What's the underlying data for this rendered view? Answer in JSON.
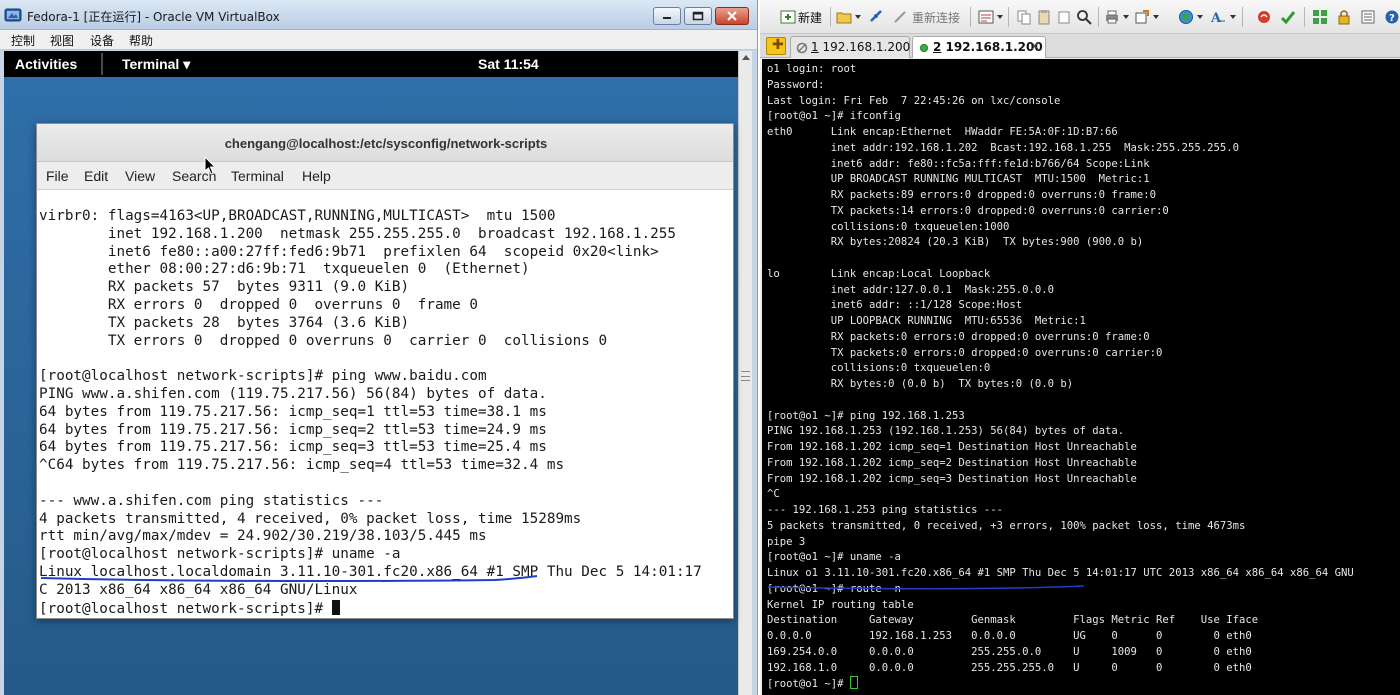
{
  "vbox": {
    "title": "Fedora-1 [正在运行] - Oracle VM VirtualBox",
    "menu": [
      "控制",
      "视图",
      "设备",
      "帮助"
    ]
  },
  "gnome": {
    "activities": "Activities",
    "app_menu": "Terminal ▾",
    "clock": "Sat 11:54"
  },
  "guest_terminal": {
    "title": "chengang@localhost:/etc/sysconfig/network-scripts",
    "menu": [
      "File",
      "Edit",
      "View",
      "Search",
      "Terminal",
      "Help"
    ],
    "lines": [
      "virbr0: flags=4163<UP,BROADCAST,RUNNING,MULTICAST>  mtu 1500",
      "        inet 192.168.1.200  netmask 255.255.255.0  broadcast 192.168.1.255",
      "        inet6 fe80::a00:27ff:fed6:9b71  prefixlen 64  scopeid 0x20<link>",
      "        ether 08:00:27:d6:9b:71  txqueuelen 0  (Ethernet)",
      "        RX packets 57  bytes 9311 (9.0 KiB)",
      "        RX errors 0  dropped 0  overruns 0  frame 0",
      "        TX packets 28  bytes 3764 (3.6 KiB)",
      "        TX errors 0  dropped 0 overruns 0  carrier 0  collisions 0",
      "",
      "[root@localhost network-scripts]# ping www.baidu.com",
      "PING www.a.shifen.com (119.75.217.56) 56(84) bytes of data.",
      "64 bytes from 119.75.217.56: icmp_seq=1 ttl=53 time=38.1 ms",
      "64 bytes from 119.75.217.56: icmp_seq=2 ttl=53 time=24.9 ms",
      "64 bytes from 119.75.217.56: icmp_seq=3 ttl=53 time=25.4 ms",
      "^C64 bytes from 119.75.217.56: icmp_seq=4 ttl=53 time=32.4 ms",
      "",
      "--- www.a.shifen.com ping statistics ---",
      "4 packets transmitted, 4 received, 0% packet loss, time 15289ms",
      "rtt min/avg/max/mdev = 24.902/30.219/38.103/5.445 ms",
      "[root@localhost network-scripts]# uname -a",
      "Linux localhost.localdomain 3.11.10-301.fc20.x86_64 #1 SMP Thu Dec 5 14:01:17",
      "C 2013 x86_64 x86_64 x86_64 GNU/Linux"
    ],
    "prompt": "[root@localhost network-scripts]# "
  },
  "crt": {
    "toolbar": {
      "new_label": "新建",
      "reconnect_label": "重新连接"
    },
    "tabs": [
      {
        "number": "1",
        "label": "192.168.1.200"
      },
      {
        "number": "2",
        "label": "192.168.1.200",
        "close": "×"
      }
    ],
    "lines": [
      "o1 login: root",
      "Password:",
      "Last login: Fri Feb  7 22:45:26 on lxc/console",
      "[root@o1 ~]# ifconfig",
      "eth0      Link encap:Ethernet  HWaddr FE:5A:0F:1D:B7:66",
      "          inet addr:192.168.1.202  Bcast:192.168.1.255  Mask:255.255.255.0",
      "          inet6 addr: fe80::fc5a:fff:fe1d:b766/64 Scope:Link",
      "          UP BROADCAST RUNNING MULTICAST  MTU:1500  Metric:1",
      "          RX packets:89 errors:0 dropped:0 overruns:0 frame:0",
      "          TX packets:14 errors:0 dropped:0 overruns:0 carrier:0",
      "          collisions:0 txqueuelen:1000",
      "          RX bytes:20824 (20.3 KiB)  TX bytes:900 (900.0 b)",
      "",
      "lo        Link encap:Local Loopback",
      "          inet addr:127.0.0.1  Mask:255.0.0.0",
      "          inet6 addr: ::1/128 Scope:Host",
      "          UP LOOPBACK RUNNING  MTU:65536  Metric:1",
      "          RX packets:0 errors:0 dropped:0 overruns:0 frame:0",
      "          TX packets:0 errors:0 dropped:0 overruns:0 carrier:0",
      "          collisions:0 txqueuelen:0",
      "          RX bytes:0 (0.0 b)  TX bytes:0 (0.0 b)",
      "",
      "[root@o1 ~]# ping 192.168.1.253",
      "PING 192.168.1.253 (192.168.1.253) 56(84) bytes of data.",
      "From 192.168.1.202 icmp_seq=1 Destination Host Unreachable",
      "From 192.168.1.202 icmp_seq=2 Destination Host Unreachable",
      "From 192.168.1.202 icmp_seq=3 Destination Host Unreachable",
      "^C",
      "--- 192.168.1.253 ping statistics ---",
      "5 packets transmitted, 0 received, +3 errors, 100% packet loss, time 4673ms",
      "pipe 3",
      "[root@o1 ~]# uname -a",
      "Linux o1 3.11.10-301.fc20.x86_64 #1 SMP Thu Dec 5 14:01:17 UTC 2013 x86_64 x86_64 x86_64 GNU",
      "[root@o1 ~]# route -n",
      "Kernel IP routing table",
      "Destination     Gateway         Genmask         Flags Metric Ref    Use Iface",
      "0.0.0.0         192.168.1.253   0.0.0.0         UG    0      0        0 eth0",
      "169.254.0.0     0.0.0.0         255.255.0.0     U     1009   0        0 eth0",
      "192.168.1.0     0.0.0.0         255.255.255.0   U     0      0        0 eth0"
    ],
    "prompt": "[root@o1 ~]# "
  },
  "colors": {
    "underline_ink": "#1f3fc8",
    "crt_cursor": "#33cc33"
  }
}
